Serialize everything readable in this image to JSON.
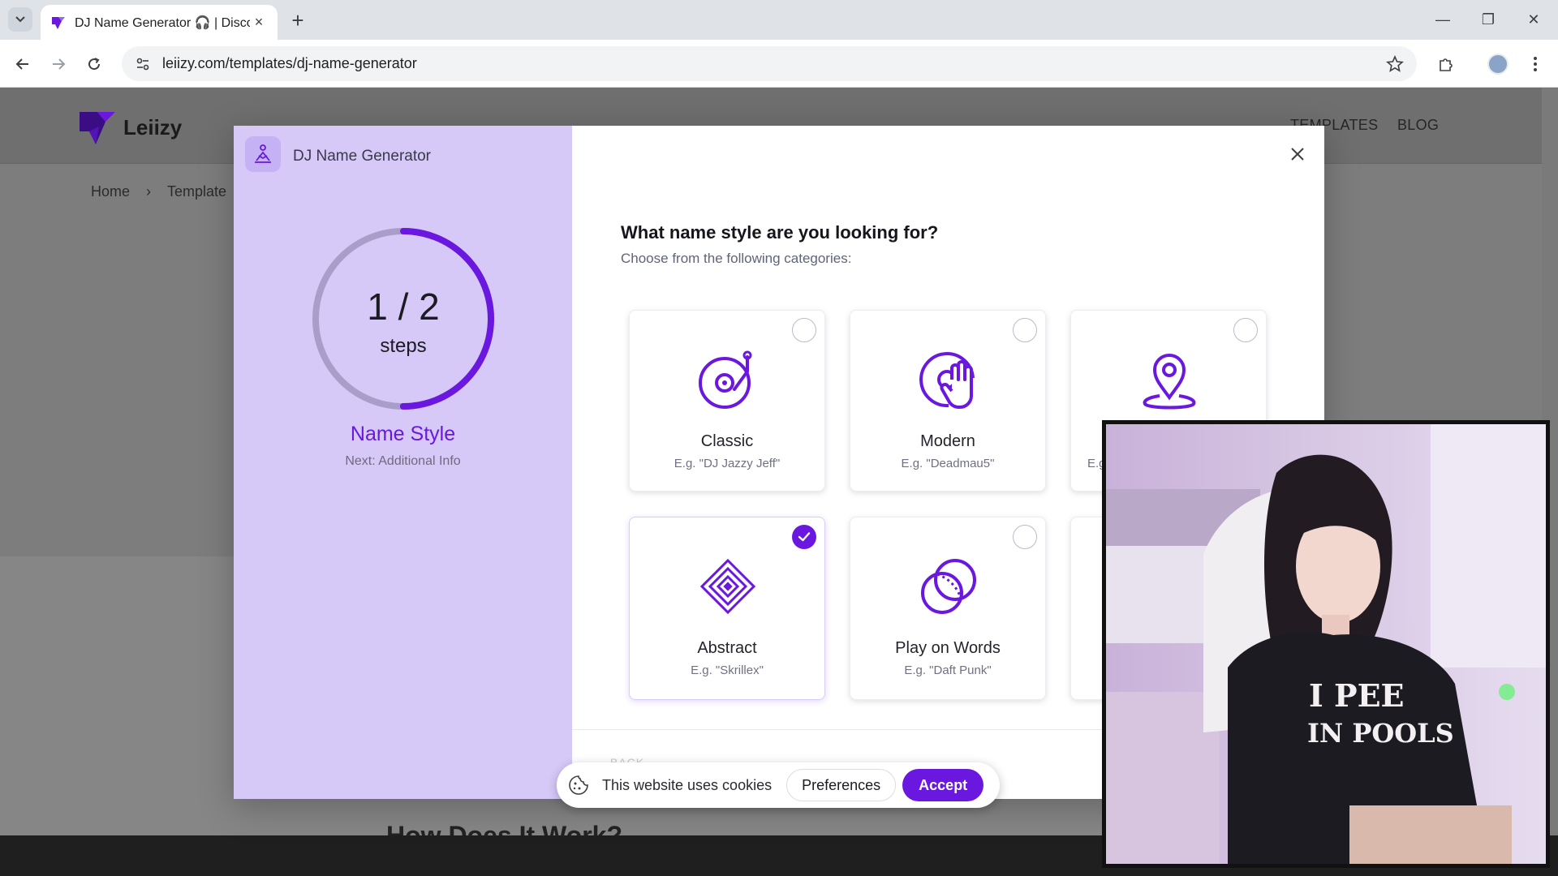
{
  "browser": {
    "tab_title": "DJ Name Generator 🎧 | Disco",
    "tab_close": "×",
    "new_tab": "+",
    "url": "leiizy.com/templates/dj-name-generator",
    "window_controls": {
      "minimize": "—",
      "restore": "❐",
      "close": "✕"
    }
  },
  "site": {
    "logo_text": "Leiizy",
    "nav": {
      "templates": "TEMPLATES",
      "blog": "BLOG"
    },
    "breadcrumb": {
      "home": "Home",
      "separator": "›",
      "current": "Template"
    },
    "section_heading": "How Does It Work?"
  },
  "modal": {
    "generator_title": "DJ Name Generator",
    "progress": {
      "step_text": "1 / 2",
      "steps_label": "steps",
      "fraction": 0.5
    },
    "stage_name": "Name Style",
    "stage_next": "Next: Additional Info",
    "question": "What name style are you looking for?",
    "subtitle": "Choose from the following categories:",
    "options": [
      {
        "name": "Classic",
        "example": "E.g. \"DJ Jazzy Jeff\"",
        "icon": "turntable-icon",
        "selected": false
      },
      {
        "name": "Modern",
        "example": "E.g. \"Deadmau5\"",
        "icon": "hand-vinyl-icon",
        "selected": false
      },
      {
        "name": "",
        "example": "E.g",
        "icon": "location-pin-icon",
        "selected": false
      },
      {
        "name": "Abstract",
        "example": "E.g. \"Skrillex\"",
        "icon": "diamond-layers-icon",
        "selected": true
      },
      {
        "name": "Play on Words",
        "example": "E.g. \"Daft Punk\"",
        "icon": "overlapping-circles-icon",
        "selected": false
      }
    ],
    "back_label": "BACK"
  },
  "cookie_bar": {
    "text": "This website uses cookies",
    "preferences": "Preferences",
    "accept": "Accept"
  },
  "webcam": {
    "shirt_text": "I PEE IN POOLS"
  },
  "colors": {
    "accent": "#6a18e0",
    "panel": "#d6c9f8",
    "page_dim": "#7d7d7d"
  }
}
